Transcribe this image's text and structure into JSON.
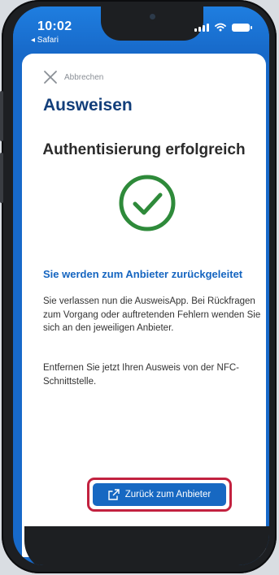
{
  "status_bar": {
    "time": "10:02",
    "back_app": "◂ Safari"
  },
  "header": {
    "cancel_label": "Abbrechen",
    "title": "Ausweisen"
  },
  "main": {
    "result_title": "Authentisierung erfolgreich",
    "heading": "Sie werden zum Anbieter zurückgeleitet",
    "paragraph_1": "Sie verlassen nun die AusweisApp. Bei Rückfragen zum Vorgang oder auftretenden Fehlern wenden Sie sich an den jeweiligen Anbieter.",
    "paragraph_2": "Entfernen Sie jetzt Ihren Ausweis von der NFC-Schnittstelle."
  },
  "action": {
    "button_label": "Zurück zum Anbieter"
  },
  "colors": {
    "brand_blue": "#1565c0",
    "title_blue": "#123e7a",
    "success_green": "#2e8a3a",
    "highlight_red": "#c2213f"
  },
  "icons": [
    "close-icon",
    "checkmark-circle-icon",
    "external-link-icon",
    "signal-icon",
    "wifi-icon",
    "battery-icon"
  ]
}
